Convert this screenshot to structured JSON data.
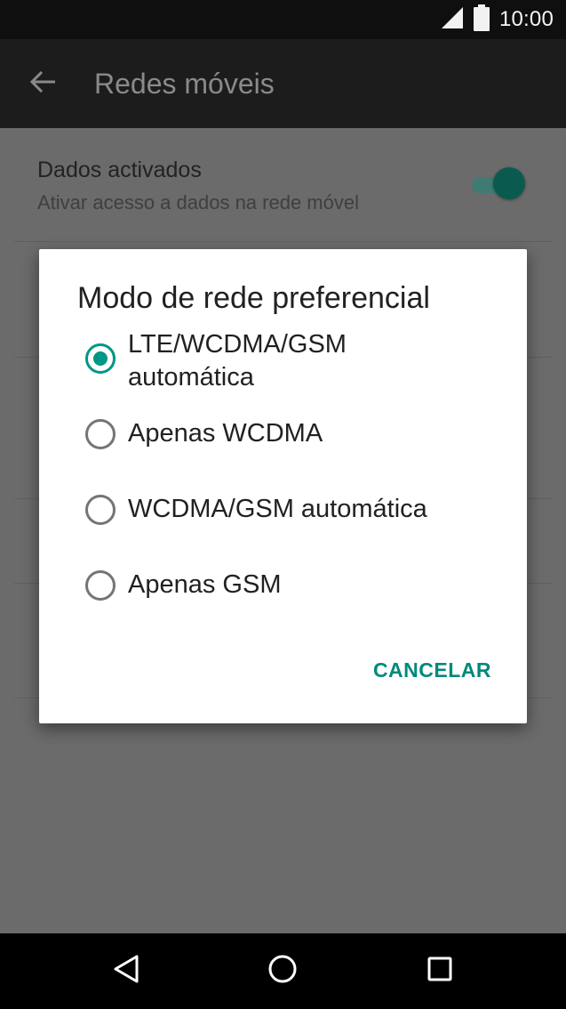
{
  "status_bar": {
    "time": "10:00",
    "icons": [
      "signal-icon",
      "battery-icon"
    ]
  },
  "app_bar": {
    "title": "Redes móveis",
    "back_icon": "back-arrow-icon"
  },
  "settings": {
    "items": [
      {
        "title": "Dados activados",
        "summary": "Ativar acesso a dados na rede móvel",
        "toggle_on": true
      }
    ]
  },
  "dialog": {
    "title": "Modo de rede preferencial",
    "options": [
      {
        "label_line1": "LTE/WCDMA/GSM",
        "label_line2": "automática",
        "selected": true
      },
      {
        "label": "Apenas WCDMA",
        "selected": false
      },
      {
        "label": "WCDMA/GSM automática",
        "selected": false
      },
      {
        "label": "Apenas GSM",
        "selected": false
      }
    ],
    "cancel_label": "CANCELAR"
  },
  "nav_bar": {
    "buttons": [
      "back-triangle-icon",
      "home-circle-icon",
      "recents-square-icon"
    ]
  },
  "colors": {
    "accent": "#009688",
    "scrim_bg": "#6b6b6b",
    "toggle_thumb": "#0b5a4f"
  }
}
